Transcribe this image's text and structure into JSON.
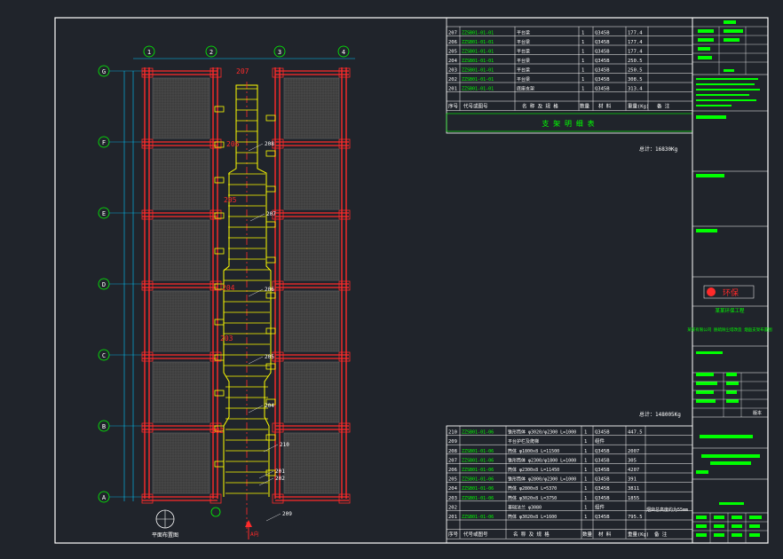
{
  "axes_top": [
    "1",
    "2",
    "3",
    "4"
  ],
  "axes_left": [
    "G",
    "F",
    "E",
    "D",
    "C",
    "B",
    "A"
  ],
  "member_labels_red": [
    "207",
    "206",
    "205",
    "204",
    "203",
    "202"
  ],
  "member_labels_white": [
    "208",
    "207",
    "206",
    "205",
    "204",
    "210",
    "201",
    "202",
    "209"
  ],
  "plan_caption": "平面布置图",
  "arrow_label": "A向",
  "table_top": {
    "rows": [
      {
        "no": "207",
        "code": "ZZSB01-01-01",
        "name": "平台梁",
        "qty": "1",
        "mat": "Q345B",
        "w": "177.4"
      },
      {
        "no": "206",
        "code": "ZZSB01-01-01",
        "name": "平台梁",
        "qty": "1",
        "mat": "Q345B",
        "w": "177.4"
      },
      {
        "no": "205",
        "code": "ZZSB01-01-01",
        "name": "平台梁",
        "qty": "1",
        "mat": "Q345B",
        "w": "177.4"
      },
      {
        "no": "204",
        "code": "ZZSB01-01-01",
        "name": "平台梁",
        "qty": "1",
        "mat": "Q345B",
        "w": "250.5"
      },
      {
        "no": "203",
        "code": "ZZSB01-01-01",
        "name": "平台梁",
        "qty": "1",
        "mat": "Q345B",
        "w": "250.5"
      },
      {
        "no": "202",
        "code": "ZZSB01-01-01",
        "name": "平台梁",
        "qty": "1",
        "mat": "Q345B",
        "w": "308.5"
      },
      {
        "no": "201",
        "code": "ZZSB01-01-01",
        "name": "底座支架",
        "qty": "1",
        "mat": "Q345B",
        "w": "313.4"
      }
    ],
    "footer": "支 架 明 细 表",
    "total": "总计：16830Kg"
  },
  "table_bottom": {
    "total": "总计：148005Kg",
    "rows": [
      {
        "no": "210",
        "code": "ZZSB01-01-06",
        "name": "锥形筒体 φ3020/φ2300",
        "len": "L=1000",
        "qty": "1",
        "mat": "Q345B",
        "w": "447.5"
      },
      {
        "no": "209",
        "code": "",
        "name": "平台护栏及爬梯",
        "len": "",
        "qty": "1",
        "mat": "组件",
        "w": ""
      },
      {
        "no": "208",
        "code": "ZZSB01-01-06",
        "name": "筒体 φ1800x8",
        "len": "L=11500",
        "qty": "1",
        "mat": "Q345B",
        "w": "2007"
      },
      {
        "no": "207",
        "code": "ZZSB01-01-06",
        "name": "锥形筒体 φ2300/φ1800",
        "len": "L=1000",
        "qty": "1",
        "mat": "Q345B",
        "w": "305"
      },
      {
        "no": "206",
        "code": "ZZSB01-01-06",
        "name": "筒体 φ2300x8",
        "len": "L=11450",
        "qty": "1",
        "mat": "Q345B",
        "w": "4207"
      },
      {
        "no": "205",
        "code": "ZZSB01-01-06",
        "name": "锥形筒体 φ2800/φ2300",
        "len": "L=1000",
        "qty": "1",
        "mat": "Q345B",
        "w": "391"
      },
      {
        "no": "204",
        "code": "ZZSB01-01-06",
        "name": "筒体 φ2800x8",
        "len": "L=5370",
        "qty": "1",
        "mat": "Q345B",
        "w": "3811"
      },
      {
        "no": "203",
        "code": "ZZSB01-01-06",
        "name": "筒体 φ3020x8",
        "len": "L=3750",
        "qty": "1",
        "mat": "Q345B",
        "w": "1855"
      },
      {
        "no": "202",
        "code": "",
        "name": "基础法兰 φ3080",
        "len": "",
        "qty": "1",
        "mat": "组件",
        "w": ""
      },
      {
        "no": "201",
        "code": "ZZSB01-01-06",
        "name": "筒体 φ3020x8",
        "len": "L=1600",
        "qty": "1",
        "mat": "Q345B",
        "w": "795.5"
      }
    ],
    "note": "烟囱总高度约为55mm"
  },
  "table_headers": [
    "序号",
    "代号或图号",
    "名 称 及 规 格",
    "数量",
    "材 料",
    "重量(Kg)",
    "备 注"
  ],
  "title_block": {
    "company": "某某环保工程",
    "drawing_title": "某某有限公司 脱硫除尘塔改造 烟囱支架布置图",
    "logo_text": "环保",
    "footer_text": "版本"
  },
  "colors": {
    "background": "#20242b",
    "frame": "#ffffff",
    "grid": "#ff2a2a",
    "steel": "#ffff00",
    "text": "#ffffff",
    "accent": "#00ff00",
    "dims": "#00c8ff"
  }
}
